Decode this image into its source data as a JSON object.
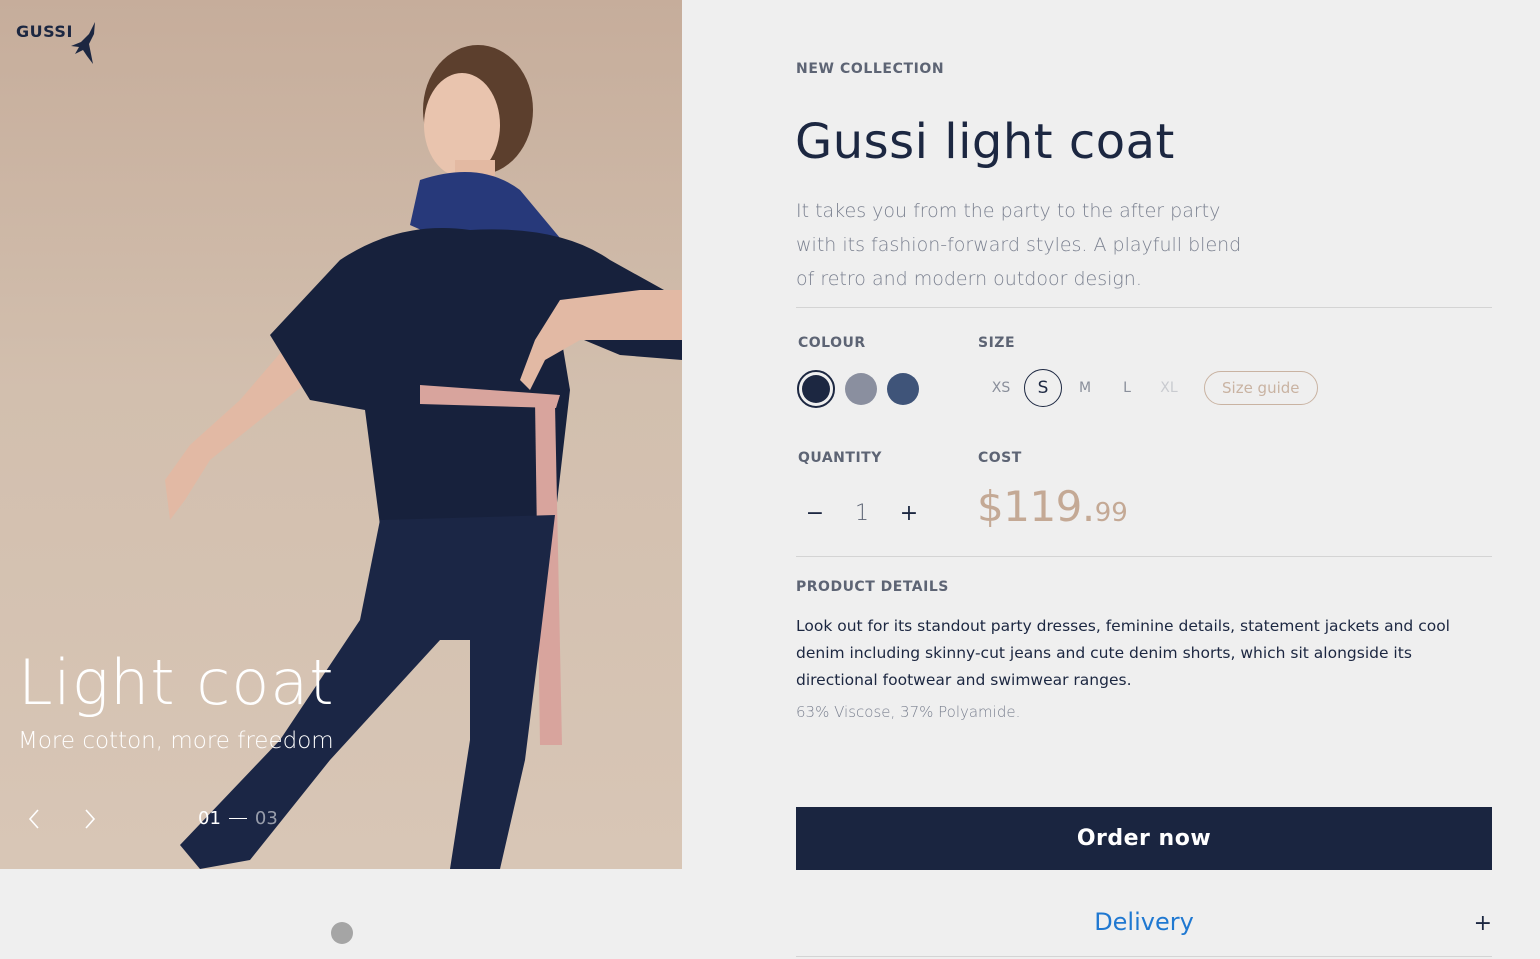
{
  "brand": {
    "name": "GUSSI"
  },
  "hero": {
    "title": "Light coat",
    "subtitle": "More cotton, more freedom",
    "counter_current": "01",
    "counter_total": "03"
  },
  "product": {
    "eyebrow": "NEW COLLECTION",
    "title": "Gussi light coat",
    "description": "It takes you from the party to the after party with its fashion-forward styles. A playfull blend of retro and modern outdoor design."
  },
  "options": {
    "colour_label": "COLOUR",
    "size_label": "SIZE",
    "colours": [
      {
        "name": "navy",
        "hex": "#1c2741",
        "selected": true
      },
      {
        "name": "grey",
        "hex": "#8a8f9f",
        "selected": false
      },
      {
        "name": "blue",
        "hex": "#3f5479",
        "selected": false
      }
    ],
    "sizes": [
      {
        "label": "XS",
        "state": "available"
      },
      {
        "label": "S",
        "state": "selected"
      },
      {
        "label": "M",
        "state": "available"
      },
      {
        "label": "L",
        "state": "available"
      },
      {
        "label": "XL",
        "state": "disabled"
      }
    ],
    "size_guide": "Size guide"
  },
  "purchase": {
    "quantity_label": "QUANTITY",
    "cost_label": "COST",
    "quantity": "1",
    "minus": "−",
    "plus": "+",
    "price_main": "$119.",
    "price_cents": "99"
  },
  "details": {
    "label": "PRODUCT DETAILS",
    "text": "Look out for its standout party dresses, feminine details, statement jackets and cool denim including skinny-cut jeans and cute denim shorts, which sit alongside its directional footwear and swimwear ranges.",
    "composition": "63% Viscose, 37% Polyamide."
  },
  "actions": {
    "order": "Order now",
    "delivery": "Delivery",
    "delivery_toggle": "+"
  },
  "colors": {
    "primary": "#1a2540",
    "accent": "#c4a995",
    "link": "#1f78d1",
    "background": "#efefef"
  }
}
